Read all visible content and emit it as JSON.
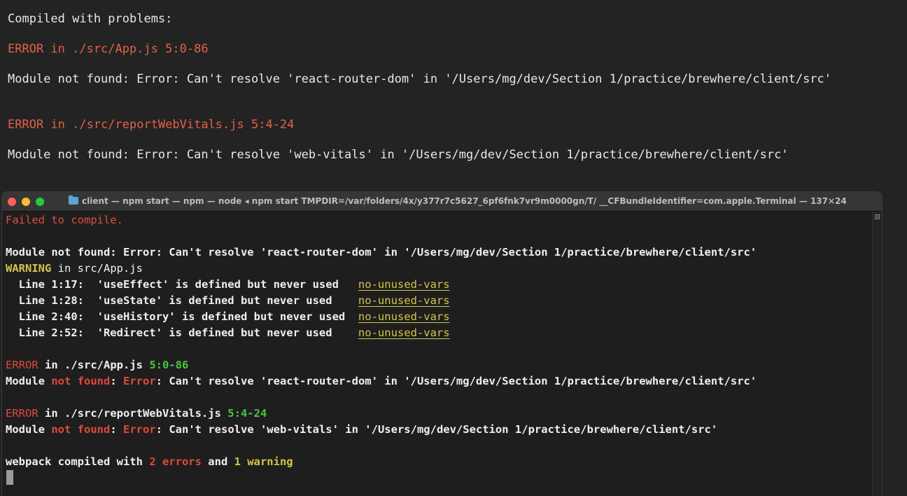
{
  "overlay": {
    "heading": "Compiled with problems:",
    "errors": [
      {
        "title": "ERROR in ./src/App.js 5:0-86",
        "message": "Module not found: Error: Can't resolve 'react-router-dom' in '/Users/mg/dev/Section 1/practice/brewhere/client/src'"
      },
      {
        "title": "ERROR in ./src/reportWebVitals.js 5:4-24",
        "message": "Module not found: Error: Can't resolve 'web-vitals' in '/Users/mg/dev/Section 1/practice/brewhere/client/src'"
      }
    ]
  },
  "terminal": {
    "title": "client — npm start — npm — node ◂ npm start TMPDIR=/var/folders/4x/y377r7c5627_6pf6fnk7vr9m0000gn/T/ __CFBundleIdentifier=com.apple.Terminal — 137×24",
    "failed": "Failed to compile.",
    "module_error_1": "Module not found: Error: Can't resolve 'react-router-dom' in '/Users/mg/dev/Section 1/practice/brewhere/client/src'",
    "warning_label": "WARNING",
    "warning_file": " in src/App.js",
    "lint_rule": "no-unused-vars",
    "lint": [
      {
        "text": "  Line 1:17:  'useEffect' is defined but never used   "
      },
      {
        "text": "  Line 1:28:  'useState' is defined but never used    "
      },
      {
        "text": "  Line 2:40:  'useHistory' is defined but never used  "
      },
      {
        "text": "  Line 2:52:  'Redirect' is defined but never used    "
      }
    ],
    "error_label": "ERROR",
    "err1_in": " in ./src/App.js ",
    "err1_loc": "5:0-86",
    "err2_in": " in ./src/reportWebVitals.js ",
    "err2_loc": "5:4-24",
    "mod_word": "Module ",
    "not_found": "not found",
    "colon": ": ",
    "error_word": "Error",
    "err1_rest": ": Can't resolve 'react-router-dom' in '/Users/mg/dev/Section 1/practice/brewhere/client/src'",
    "err2_rest": ": Can't resolve 'web-vitals' in '/Users/mg/dev/Section 1/practice/brewhere/client/src'",
    "summary_pre": "webpack compiled with ",
    "summary_errors": "2 errors",
    "summary_mid": " and ",
    "summary_warning": "1 warning"
  }
}
